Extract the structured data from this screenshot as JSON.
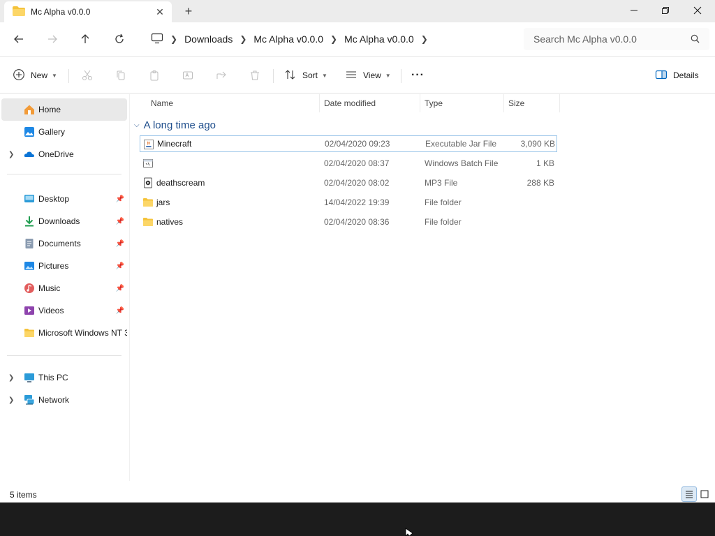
{
  "window": {
    "tab_title": "Mc Alpha v0.0.0",
    "new_tab": "+",
    "close_tab": "✕"
  },
  "address": {
    "breadcrumbs": [
      "Downloads",
      "Mc Alpha v0.0.0",
      "Mc Alpha v0.0.0"
    ],
    "search_placeholder": "Search Mc Alpha v0.0.0"
  },
  "commands": {
    "new_label": "New",
    "sort_label": "Sort",
    "view_label": "View",
    "more_label": "···",
    "details_label": "Details"
  },
  "sidebar": {
    "items": [
      {
        "label": "Home",
        "icon": "home-icon"
      },
      {
        "label": "Gallery",
        "icon": "gallery-icon"
      },
      {
        "label": "OneDrive",
        "icon": "onedrive-icon"
      },
      {
        "label": "Desktop",
        "icon": "desktop-icon"
      },
      {
        "label": "Downloads",
        "icon": "downloads-icon"
      },
      {
        "label": "Documents",
        "icon": "documents-icon"
      },
      {
        "label": "Pictures",
        "icon": "pictures-icon"
      },
      {
        "label": "Music",
        "icon": "music-icon"
      },
      {
        "label": "Videos",
        "icon": "videos-icon"
      },
      {
        "label": "Microsoft Windows NT 3",
        "icon": "folder-icon"
      },
      {
        "label": "This PC",
        "icon": "this-pc-icon"
      },
      {
        "label": "Network",
        "icon": "network-icon"
      }
    ]
  },
  "columns": {
    "name": "Name",
    "date": "Date modified",
    "type": "Type",
    "size": "Size"
  },
  "group": {
    "title": "A long time ago"
  },
  "files": [
    {
      "name": "Minecraft",
      "date": "02/04/2020 09:23",
      "type": "Executable Jar File",
      "size": "3,090 KB",
      "icon": "jar-file-icon"
    },
    {
      "name": "",
      "date": "02/04/2020 08:37",
      "type": "Windows Batch File",
      "size": "1 KB",
      "icon": "batch-file-icon"
    },
    {
      "name": "deathscream",
      "date": "02/04/2020 08:02",
      "type": "MP3 File",
      "size": "288 KB",
      "icon": "mp3-file-icon"
    },
    {
      "name": "jars",
      "date": "14/04/2022 19:39",
      "type": "File folder",
      "size": "",
      "icon": "folder-icon"
    },
    {
      "name": "natives",
      "date": "02/04/2020 08:36",
      "type": "File folder",
      "size": "",
      "icon": "folder-icon"
    }
  ],
  "status": {
    "item_count": "5 items"
  },
  "colors": {
    "accent": "#0067c0",
    "folder": "#f5c33b",
    "group_title": "#1f4e8c"
  }
}
